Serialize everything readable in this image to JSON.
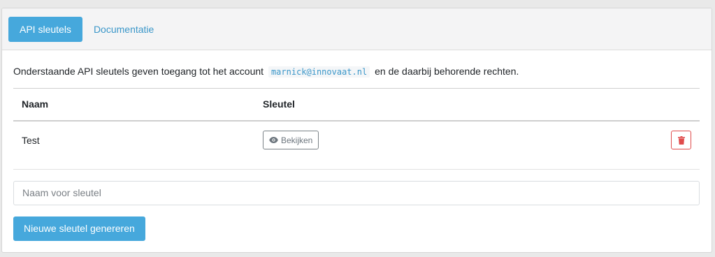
{
  "tabs": [
    {
      "label": "API sleutels",
      "active": true
    },
    {
      "label": "Documentatie",
      "active": false
    }
  ],
  "intro": {
    "before": "Onderstaande API sleutels geven toegang tot het account",
    "account": "marnick@innovaat.nl",
    "after": "en de daarbij behorende rechten."
  },
  "table": {
    "headers": {
      "name": "Naam",
      "key": "Sleutel"
    },
    "rows": [
      {
        "name": "Test",
        "view_label": "Bekijken"
      }
    ]
  },
  "form": {
    "name_placeholder": "Naam voor sleutel",
    "name_value": "",
    "generate_label": "Nieuwe sleutel genereren"
  },
  "icons": {
    "view": "eye-icon",
    "delete": "trash-icon"
  },
  "colors": {
    "primary": "#46a8dc",
    "link": "#3b97c9",
    "danger": "#e04b4b",
    "secondary": "#6c757d"
  }
}
